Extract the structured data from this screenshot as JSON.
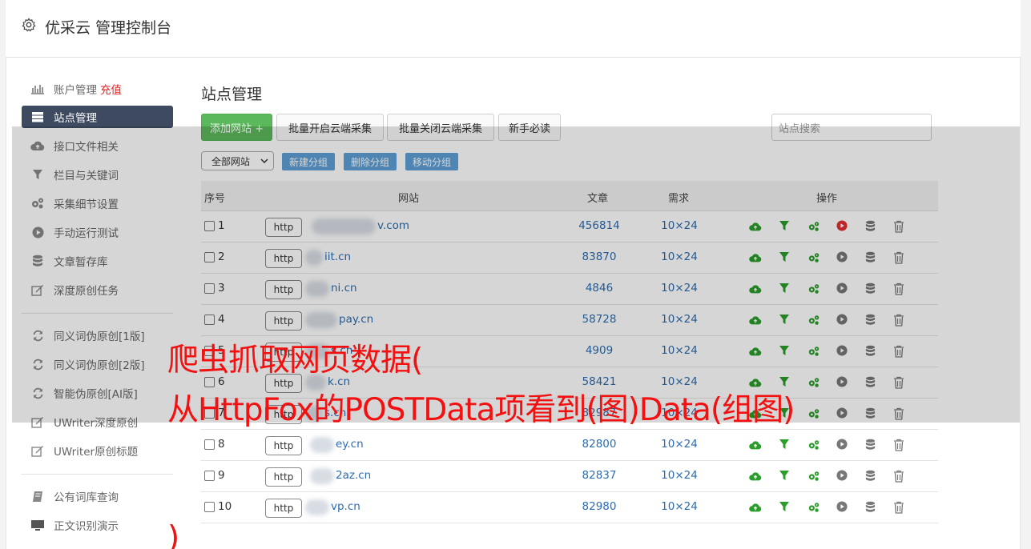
{
  "header": {
    "title": "优采云 管理控制台",
    "icon": "gear-icon"
  },
  "sidebar": {
    "items": [
      {
        "label": "账户管理",
        "extra": "充值",
        "icon": "bar-chart-icon"
      },
      {
        "label": "站点管理",
        "icon": "server-icon",
        "active": true
      },
      {
        "label": "接口文件相关",
        "icon": "cloud-upload-icon"
      },
      {
        "label": "栏目与关键词",
        "icon": "filter-icon"
      },
      {
        "label": "采集细节设置",
        "icon": "cogs-icon"
      },
      {
        "label": "手动运行测试",
        "icon": "play-circle-icon"
      },
      {
        "label": "文章暂存库",
        "icon": "database-icon"
      },
      {
        "label": "深度原创任务",
        "icon": "edit-icon"
      },
      {
        "label": "同义词伪原创[1版]",
        "icon": "refresh-icon"
      },
      {
        "label": "同义词伪原创[2版]",
        "icon": "refresh-icon"
      },
      {
        "label": "智能伪原创[AI版]",
        "icon": "refresh-icon"
      },
      {
        "label": "UWriter深度原创",
        "icon": "edit-icon"
      },
      {
        "label": "UWriter原创标题",
        "icon": "edit-icon"
      },
      {
        "label": "公有词库查询",
        "icon": "book-icon"
      },
      {
        "label": "正文识别演示",
        "icon": "monitor-icon"
      }
    ]
  },
  "main": {
    "title": "站点管理",
    "toolbar": {
      "add": "添加网站 +",
      "batch_open": "批量开启云端采集",
      "batch_close": "批量关闭云端采集",
      "newbie": "新手必读",
      "search_placeholder": "站点搜索"
    },
    "group_bar": {
      "select_value": "全部网站",
      "new_group": "新建分组",
      "delete_group": "删除分组",
      "move_group": "移动分组"
    },
    "table": {
      "headers": {
        "no": "序号",
        "site": "网站",
        "articles": "文章",
        "demand": "需求",
        "ops": "操作"
      },
      "protocol": "http",
      "rows": [
        {
          "no": "1",
          "site": "v.com",
          "articles": "456814",
          "demand": "10×24",
          "play_color": "#e03030"
        },
        {
          "no": "2",
          "site": "iit.cn",
          "articles": "83870",
          "demand": "10×24"
        },
        {
          "no": "3",
          "site": "ni.cn",
          "articles": "4846",
          "demand": "10×24"
        },
        {
          "no": "4",
          "site": "pay.cn",
          "articles": "58728",
          "demand": "10×24"
        },
        {
          "no": "5",
          "site": "s.cn",
          "articles": "4909",
          "demand": "10×24"
        },
        {
          "no": "6",
          "site": "k.cn",
          "articles": "58421",
          "demand": "10×24"
        },
        {
          "no": "7",
          "site": "s.cn",
          "articles": "82987",
          "demand": "10×24"
        },
        {
          "no": "8",
          "site": "ey.cn",
          "articles": "82800",
          "demand": "10×24"
        },
        {
          "no": "9",
          "site": "2az.cn",
          "articles": "82837",
          "demand": "10×24"
        },
        {
          "no": "10",
          "site": "vp.cn",
          "articles": "82980",
          "demand": "10×24"
        }
      ],
      "op_icons": [
        "cloud-upload-icon",
        "filter-icon",
        "cogs-icon",
        "play-icon",
        "database-icon",
        "trash-icon"
      ]
    }
  },
  "watermark": {
    "line1": "爬虫抓取网页数据(",
    "line2": "从HttpFox的POSTData项看到(图)Data(组图)",
    "line3": ")"
  },
  "colors": {
    "accent_green": "#5cb85c",
    "sidebar_active": "#3d4a60",
    "link_blue": "#2b6cb0",
    "watermark_red": "#f21010",
    "op_green": "#2a9d2a"
  }
}
